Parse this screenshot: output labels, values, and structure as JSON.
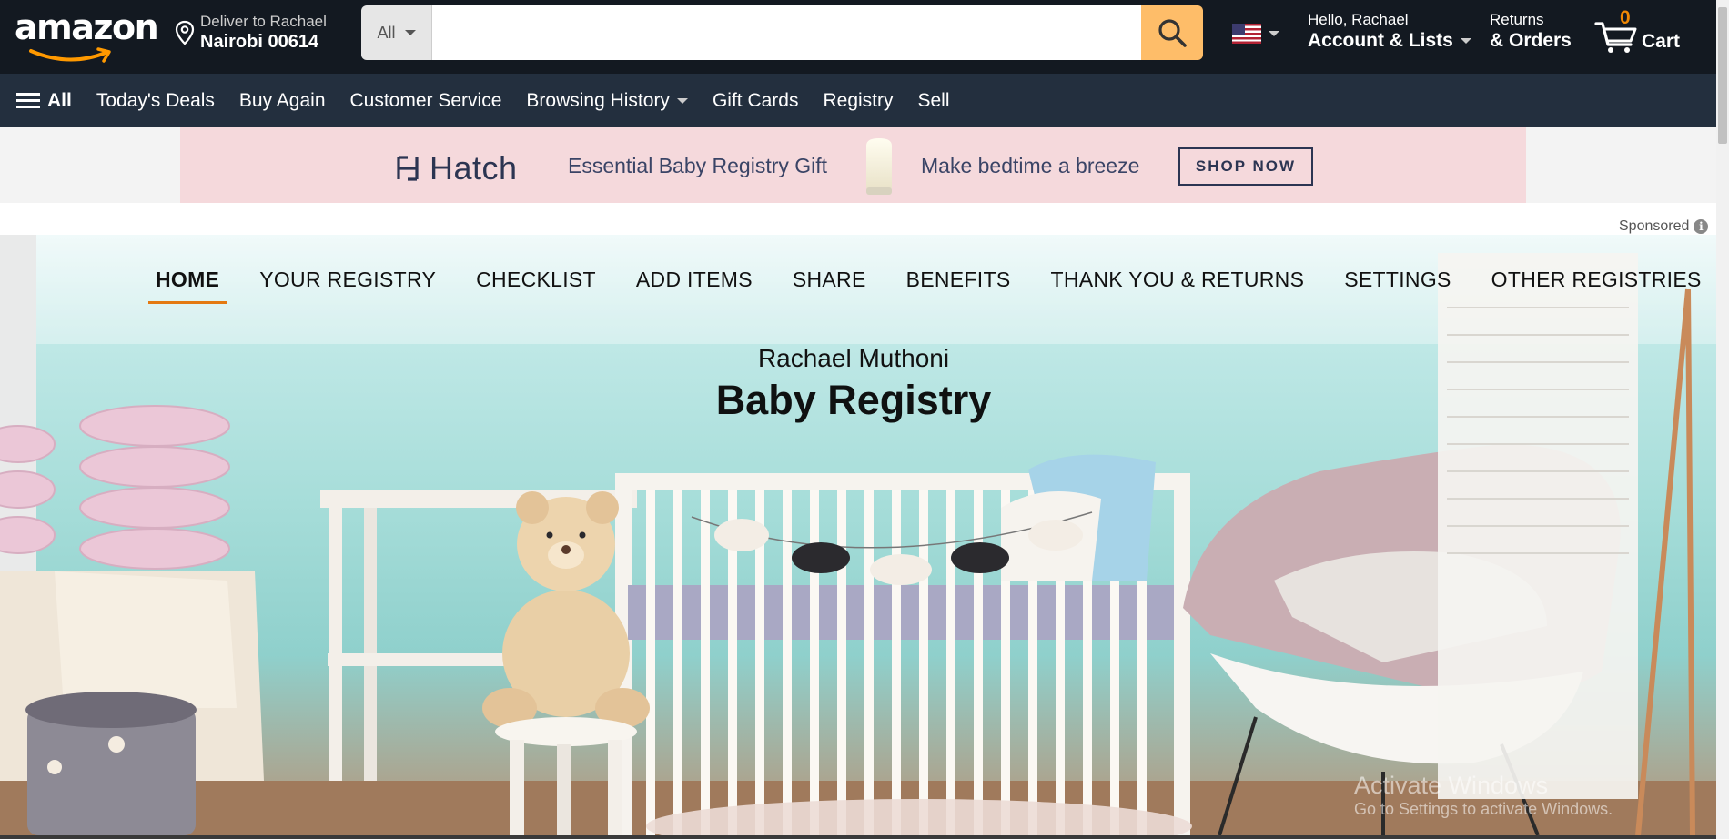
{
  "header": {
    "logo_text": "amazon",
    "deliver_line1": "Deliver to Rachael",
    "deliver_line2": "Nairobi 00614",
    "search_category": "All",
    "search_placeholder": "",
    "account_line1": "Hello, Rachael",
    "account_line2": "Account & Lists",
    "orders_line1": "Returns",
    "orders_line2": "& Orders",
    "cart_count": "0",
    "cart_label": "Cart"
  },
  "subnav": {
    "all_label": "All",
    "items": [
      "Today's Deals",
      "Buy Again",
      "Customer Service",
      "Browsing History",
      "Gift Cards",
      "Registry",
      "Sell"
    ]
  },
  "ad": {
    "brand": "Hatch",
    "tagline1": "Essential Baby Registry Gift",
    "tagline2": "Make bedtime a breeze",
    "button": "SHOP NOW",
    "sponsored": "Sponsored"
  },
  "registry": {
    "tabs": [
      "HOME",
      "YOUR REGISTRY",
      "CHECKLIST",
      "ADD ITEMS",
      "SHARE",
      "BENEFITS",
      "THANK YOU & RETURNS",
      "SETTINGS",
      "OTHER REGISTRIES"
    ],
    "active_tab": "HOME",
    "owner": "Rachael Muthoni",
    "title": "Baby Registry"
  },
  "watermark": {
    "line1": "Activate Windows",
    "line2": "Go to Settings to activate Windows."
  },
  "colors": {
    "nav_bg": "#131921",
    "subnav_bg": "#232f3e",
    "search_button": "#febd69",
    "accent": "#e47911",
    "cart_count": "#f08804",
    "ad_bg": "#f5d9dc"
  }
}
